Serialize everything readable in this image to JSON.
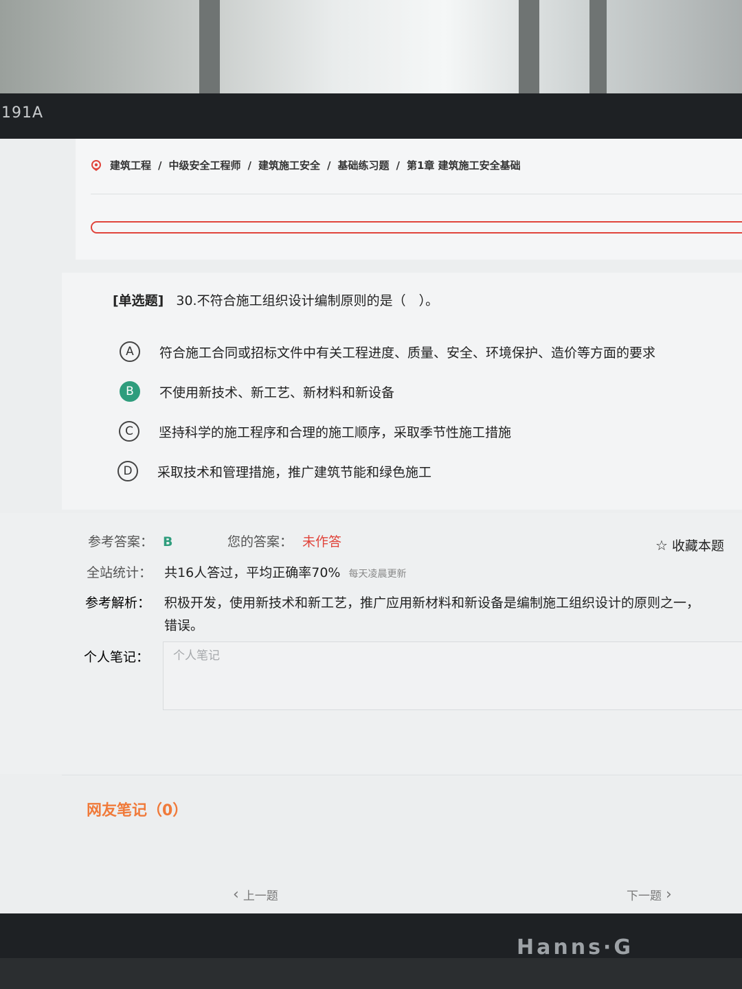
{
  "monitor": {
    "model_label": "191A",
    "brand": "Hanns·G"
  },
  "breadcrumb": {
    "icon": "location-pin-icon",
    "items": [
      "建筑工程",
      "中级安全工程师",
      "建筑施工安全",
      "基础练习题",
      "第1章 建筑施工安全基础"
    ],
    "separator": "/"
  },
  "question": {
    "type_label": "[单选题]",
    "text": "30.不符合施工组织设计编制原则的是（　）。",
    "options": [
      {
        "letter": "A",
        "text": "符合施工合同或招标文件中有关工程进度、质量、安全、环境保护、造价等方面的要求",
        "selected": false
      },
      {
        "letter": "B",
        "text": "不使用新技术、新工艺、新材料和新设备",
        "selected": true
      },
      {
        "letter": "C",
        "text": "坚持科学的施工程序和合理的施工顺序，采取季节性施工措施",
        "selected": false
      },
      {
        "letter": "D",
        "text": "采取技术和管理措施，推广建筑节能和绿色施工",
        "selected": false
      }
    ]
  },
  "answer": {
    "ref_label": "参考答案：",
    "ref_value": "B",
    "your_label": "您的答案：",
    "your_value": "未作答",
    "favorite_label": "收藏本题",
    "stats_label": "全站统计：",
    "stats_value": "共16人答过，平均正确率70%",
    "stats_note": "每天凌晨更新",
    "analysis_label": "参考解析：",
    "analysis_line1": "积极开发，使用新技术和新工艺，推广应用新材料和新设备是编制施工组织设计的原则之一，",
    "analysis_line2": "错误。",
    "note_label": "个人笔记：",
    "note_placeholder": "个人笔记"
  },
  "netnotes": {
    "label": "网友笔记（0）"
  },
  "nav": {
    "prev_label": "上一题",
    "next_label": "下一题"
  },
  "colors": {
    "accent_red": "#e0433a",
    "selected_green": "#2f9d7d",
    "orange": "#f07a3a"
  }
}
